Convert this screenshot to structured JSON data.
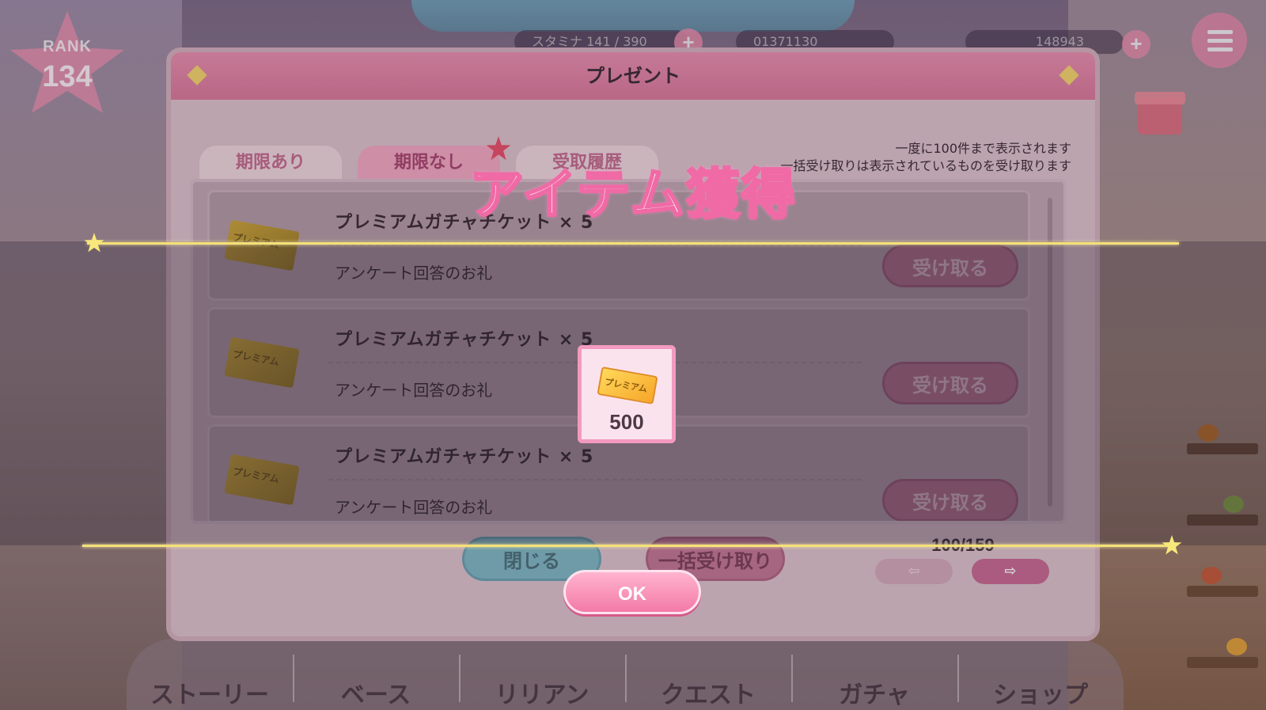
{
  "hud": {
    "rank_label": "RANK",
    "rank_value": "134",
    "stamina_text": "スタミナ 141 / 390",
    "coin_text": "01371130",
    "gem_text": "148943"
  },
  "nav": {
    "items": [
      {
        "label": "ストーリー"
      },
      {
        "label": "ベース"
      },
      {
        "label": "リリアン"
      },
      {
        "label": "クエスト"
      },
      {
        "label": "ガチャ"
      },
      {
        "label": "ショップ"
      }
    ]
  },
  "present_dialog": {
    "title": "プレゼント",
    "tabs": [
      {
        "label": "期限あり"
      },
      {
        "label": "期限なし"
      },
      {
        "label": "受取履歴"
      }
    ],
    "info_line_1": "一度に100件まで表示されます",
    "info_line_2": "一括受け取りは表示されているものを受け取ります",
    "rows": [
      {
        "name": "プレミアムガチャチケット × 5",
        "desc": "アンケート回答のお礼",
        "button": "受け取る",
        "icon_text": "プレミアム"
      },
      {
        "name": "プレミアムガチャチケット × 5",
        "desc": "アンケート回答のお礼",
        "button": "受け取る",
        "icon_text": "プレミアム"
      },
      {
        "name": "プレミアムガチャチケット × 5",
        "desc": "アンケート回答のお礼",
        "button": "受け取る",
        "icon_text": "プレミアム"
      }
    ],
    "close_label": "閉じる",
    "bulk_label": "一括受け取り",
    "pager": "100/159",
    "prev_label": "⇦",
    "next_label": "⇨"
  },
  "obtained": {
    "title": "アイテム獲得",
    "item_icon_text": "プレミアム",
    "count": "500",
    "ok_label": "OK"
  },
  "colors": {
    "accent_pink": "#f37aa6",
    "gold": "#f5e07a"
  }
}
